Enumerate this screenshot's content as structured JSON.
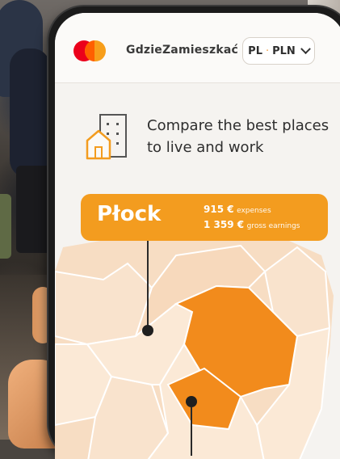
{
  "header": {
    "brand_name": "GdzieZamieszkać",
    "language": "PL",
    "separator": "·",
    "currency": "PLN"
  },
  "hero": {
    "tagline": "Compare the best places to live and work"
  },
  "callout": {
    "city": "Płock",
    "expenses_value": "915 €",
    "expenses_label": "expenses",
    "earnings_value": "1 359 €",
    "earnings_label": "gross earnings"
  },
  "colors": {
    "accent": "#f39c1f",
    "highlight_region": "#f28b1c",
    "map_base": "#f7ddc3",
    "map_light": "#fbe9d6",
    "logo_red": "#eb001b",
    "logo_yellow": "#f79e1b"
  },
  "icons": [
    "city-buildings-icon",
    "chevron-down-icon",
    "mastercard-logo-icon"
  ]
}
